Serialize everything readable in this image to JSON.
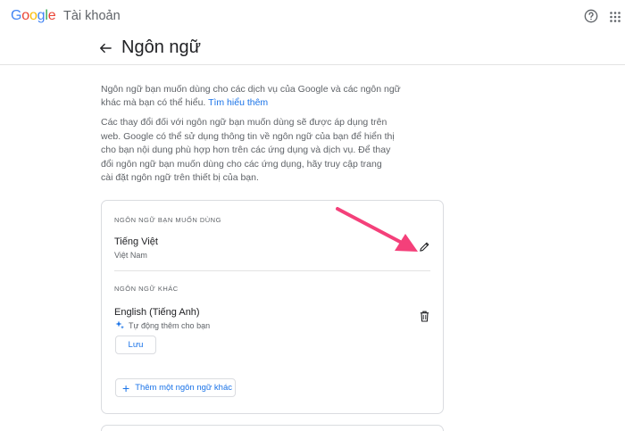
{
  "header": {
    "logo_text": "Google",
    "product": "Tài khoản"
  },
  "page": {
    "title": "Ngôn ngữ",
    "intro": "Ngôn ngữ bạn muốn dùng cho các dịch vụ của Google và các ngôn ngữ khác mà bạn có thể hiểu.",
    "learn_more": "Tìm hiểu thêm",
    "description": "Các thay đổi đối với ngôn ngữ bạn muốn dùng sẽ được áp dụng trên web. Google có thể sử dụng thông tin về ngôn ngữ của bạn để hiển thị cho bạn nội dung phù hợp hơn trên các ứng dụng và dịch vụ. Để thay đổi ngôn ngữ bạn muốn dùng cho các ứng dụng, hãy truy cập trang cài đặt ngôn ngữ trên thiết bị của bạn."
  },
  "preferred": {
    "label": "NGÔN NGỮ BẠN MUỐN DÙNG",
    "language": "Tiếng Việt",
    "region": "Việt Nam"
  },
  "other": {
    "label": "NGÔN NGỮ KHÁC",
    "language": "English (Tiếng Anh)",
    "auto_added": "Tự động thêm cho bạn",
    "save_label": "Lưu",
    "add_label": "Thêm một ngôn ngữ khác"
  },
  "colors": {
    "accent": "#1a73e8",
    "annotation_arrow": "#f4407a"
  },
  "icons": [
    "help-icon",
    "apps-grid-icon",
    "back-arrow-icon",
    "edit-pencil-icon",
    "delete-trash-icon",
    "sparkle-icon",
    "plus-icon"
  ]
}
